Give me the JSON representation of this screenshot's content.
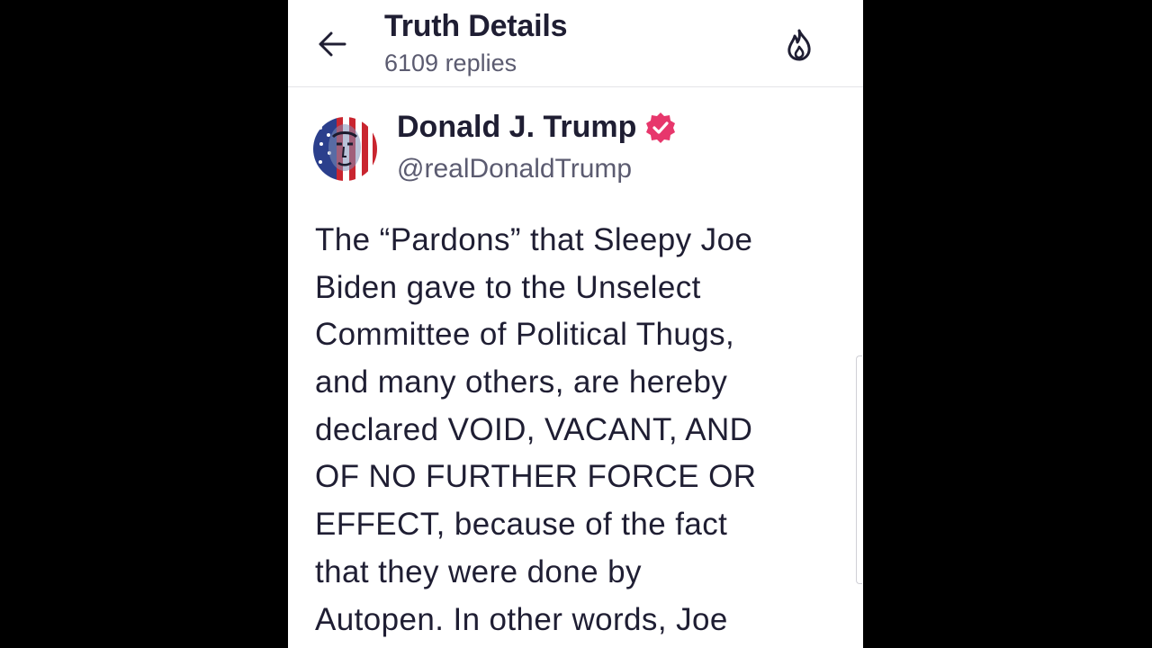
{
  "header": {
    "title": "Truth Details",
    "subtitle": "6109 replies",
    "back_icon": "arrow-left-icon",
    "action_icon": "fire-icon"
  },
  "author": {
    "name": "Donald J. Trump",
    "handle": "@realDonaldTrump",
    "verified_icon": "verified-badge-icon",
    "verified_color": "#e7376c"
  },
  "post": {
    "lines": [
      "The “Pardons” that Sleepy Joe",
      "Biden gave to the Unselect",
      "Committee of Political Thugs,",
      "and many others, are hereby",
      "declared VOID, VACANT, AND",
      "OF NO FURTHER FORCE OR",
      "EFFECT, because of the fact",
      "that they were done by",
      "Autopen. In other words, Joe"
    ]
  },
  "colors": {
    "text_primary": "#1f1e33",
    "text_secondary": "#5b5b70",
    "background": "#ffffff",
    "letterbox": "#000000"
  }
}
